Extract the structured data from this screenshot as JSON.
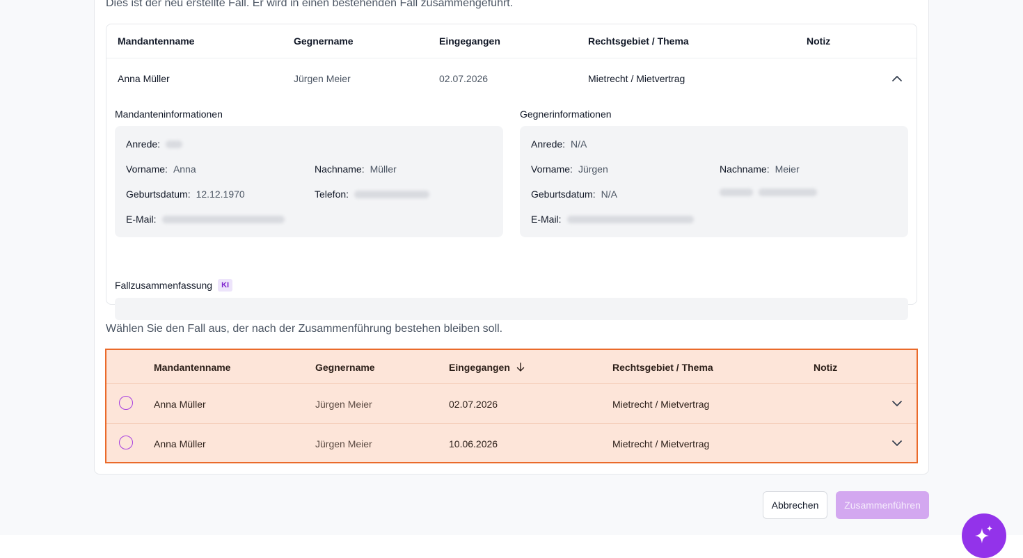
{
  "intro_text": "Dies ist der neu erstellte Fall. Er wird in einen bestehenden Fall zusammengeführt.",
  "new_case": {
    "columns": [
      "Mandantenname",
      "Gegnername",
      "Eingegangen",
      "Rechtsgebiet / Thema",
      "Notiz"
    ],
    "row": {
      "client": "Anna Müller",
      "opponent": "Jürgen Meier",
      "received": "02.07.2026",
      "area": "Mietrecht / Mietvertrag",
      "note": ""
    },
    "client_info": {
      "title": "Mandanteninformationen",
      "salutation_label": "Anrede:",
      "firstname_label": "Vorname:",
      "firstname": "Anna",
      "lastname_label": "Nachname:",
      "lastname": "Müller",
      "birthdate_label": "Geburtsdatum:",
      "birthdate": "12.12.1970",
      "phone_label": "Telefon:",
      "email_label": "E-Mail:"
    },
    "opponent_info": {
      "title": "Gegnerinformationen",
      "salutation_label": "Anrede:",
      "salutation": "N/A",
      "firstname_label": "Vorname:",
      "firstname": "Jürgen",
      "lastname_label": "Nachname:",
      "lastname": "Meier",
      "birthdate_label": "Geburtsdatum:",
      "birthdate": "N/A",
      "email_label": "E-Mail:"
    },
    "summary": {
      "title": "Fallzusammenfassung",
      "badge": "KI"
    }
  },
  "prompt_text": "Wählen Sie den Fall aus, der nach der Zusammenführung bestehen bleiben soll.",
  "existing_cases": {
    "columns": [
      "Mandantenname",
      "Gegnername",
      "Eingegangen",
      "Rechtsgebiet / Thema",
      "Notiz"
    ],
    "rows": [
      {
        "client": "Anna Müller",
        "opponent": "Jürgen Meier",
        "received": "02.07.2026",
        "area": "Mietrecht / Mietvertrag"
      },
      {
        "client": "Anna Müller",
        "opponent": "Jürgen Meier",
        "received": "10.06.2026",
        "area": "Mietrecht / Mietvertrag"
      }
    ]
  },
  "buttons": {
    "cancel": "Abbrechen",
    "merge": "Zusammenführen"
  },
  "colors": {
    "accent": "#9333ea",
    "selection_border": "#ea6a2a",
    "selection_bg": "#fde5d9"
  },
  "icons": [
    "chevron-up-icon",
    "chevron-down-icon",
    "sort-arrow-down-icon",
    "sparkle-icon"
  ]
}
